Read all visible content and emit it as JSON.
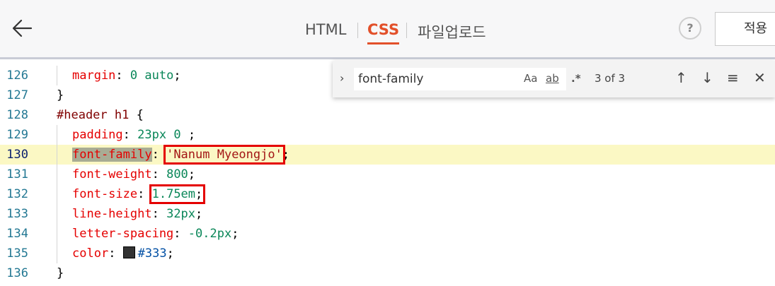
{
  "tabs": {
    "html": "HTML",
    "css": "CSS",
    "upload": "파일업로드"
  },
  "help_label": "?",
  "apply_label": "적용",
  "find": {
    "query": "font-family",
    "opt_case": "Aa",
    "opt_word": "ab",
    "opt_regex": ".*",
    "count": "3 of 3"
  },
  "code_lines": [
    {
      "n": "126",
      "text": "  margin: 0 auto;"
    },
    {
      "n": "127",
      "text": "}"
    },
    {
      "n": "128",
      "text": "#header h1 {"
    },
    {
      "n": "129",
      "text": "  padding: 23px 0 ;"
    },
    {
      "n": "130",
      "text": "  font-family: 'Nanum Myeongjo';"
    },
    {
      "n": "131",
      "text": "  font-weight: 800;"
    },
    {
      "n": "132",
      "text": "  font-size: 1.75em;"
    },
    {
      "n": "133",
      "text": "  line-height: 32px;"
    },
    {
      "n": "134",
      "text": "  letter-spacing: -0.2px;"
    },
    {
      "n": "135",
      "text": "  color: #333;"
    },
    {
      "n": "136",
      "text": "}"
    }
  ],
  "colors": {
    "accent": "#e2502a",
    "highlight_line": "#fbf8c4",
    "annotation_box": "#e40000"
  }
}
